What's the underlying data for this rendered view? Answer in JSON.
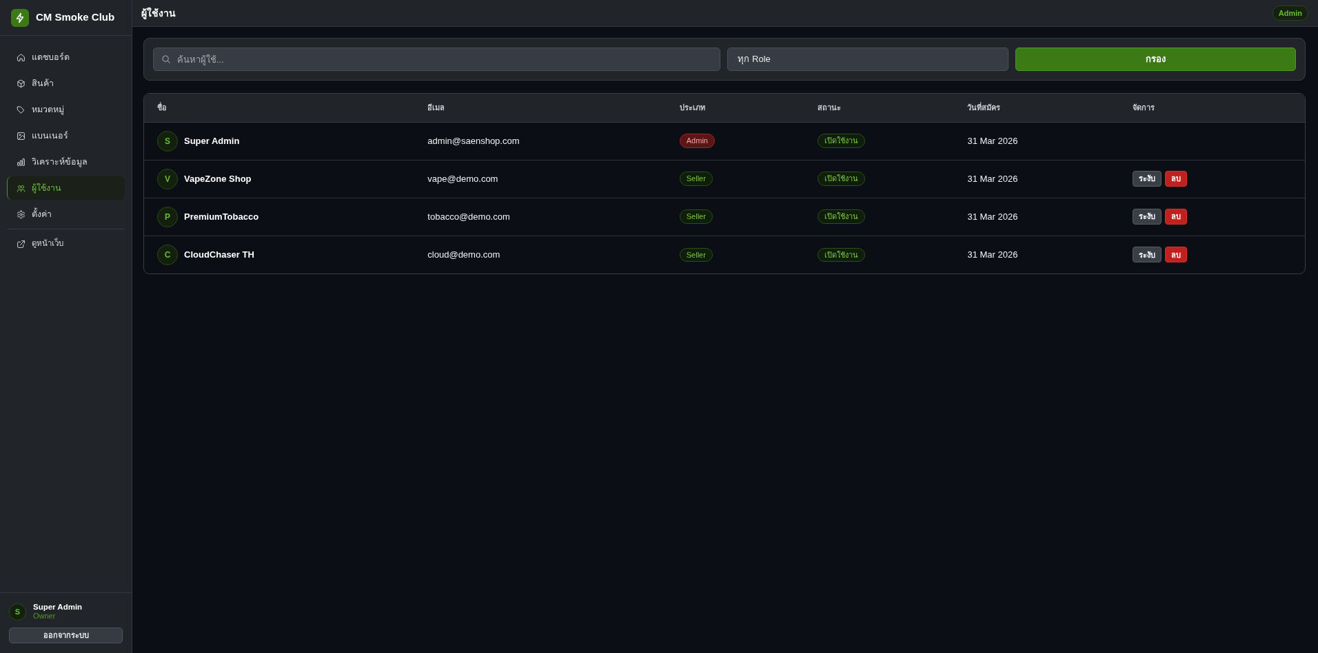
{
  "sidebar": {
    "brand": "CM Smoke Club",
    "nav": [
      {
        "label": "แดชบอร์ด",
        "selected": false
      },
      {
        "label": "สินค้า",
        "selected": false
      },
      {
        "label": "หมวดหมู่",
        "selected": false
      },
      {
        "label": "แบนเนอร์",
        "selected": false
      },
      {
        "label": "วิเคราะห์ข้อมูล",
        "selected": false
      },
      {
        "label": "ผู้ใช้งาน",
        "selected": true
      },
      {
        "label": "ตั้งค่า",
        "selected": false
      }
    ],
    "view_site_link": "ดูหน้าเว็บ",
    "user": {
      "initial": "S",
      "name": "Super Admin",
      "role": "Owner"
    },
    "logout_button": "ออกจากระบบ"
  },
  "header": {
    "title": "ผู้ใช้งาน",
    "role_badge": "Admin"
  },
  "filters": {
    "search": {
      "placeholder": "ค้นหาผู้ใช้..."
    },
    "role_select": {
      "value": "ทุก Role"
    },
    "filter_button": "กรอง"
  },
  "table": {
    "columns": [
      "ชื่อ",
      "อีเมล",
      "ประเภท",
      "สถานะ",
      "วันที่สมัคร",
      "จัดการ"
    ],
    "rows": [
      {
        "initial": "S",
        "name": "Super Admin",
        "email": "admin@saenshop.com",
        "type": {
          "label": "Admin",
          "kind": "admin"
        },
        "status": "เปิดใช้งาน",
        "joined": "31 Mar 2026"
      },
      {
        "initial": "V",
        "name": "VapeZone Shop",
        "email": "vape@demo.com",
        "type": {
          "label": "Seller",
          "kind": "seller"
        },
        "status": "เปิดใช้งาน",
        "joined": "31 Mar 2026",
        "actions": [
          {
            "label": "ระงับ",
            "kind": "suspend"
          },
          {
            "label": "ลบ",
            "kind": "delete"
          }
        ]
      },
      {
        "initial": "P",
        "name": "PremiumTobacco",
        "email": "tobacco@demo.com",
        "type": {
          "label": "Seller",
          "kind": "seller"
        },
        "status": "เปิดใช้งาน",
        "joined": "31 Mar 2026",
        "actions": [
          {
            "label": "ระงับ",
            "kind": "suspend"
          },
          {
            "label": "ลบ",
            "kind": "delete"
          }
        ]
      },
      {
        "initial": "C",
        "name": "CloudChaser TH",
        "email": "cloud@demo.com",
        "type": {
          "label": "Seller",
          "kind": "seller"
        },
        "status": "เปิดใช้งาน",
        "joined": "31 Mar 2026",
        "actions": [
          {
            "label": "ระงับ",
            "kind": "suspend"
          },
          {
            "label": "ลบ",
            "kind": "delete"
          }
        ]
      }
    ]
  }
}
